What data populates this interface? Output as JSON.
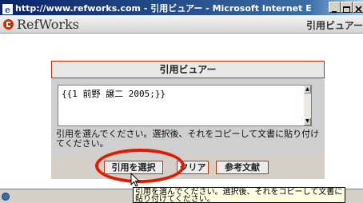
{
  "window": {
    "title": "http://www.refworks.com - 引用ビュアー - Microsoft Internet Explor..."
  },
  "header": {
    "logo_text": "RefWorks",
    "title": "引用ビュアー"
  },
  "panel": {
    "title": "引用ビュアー",
    "citation_text": "{{1 前野 譲二 2005;}}",
    "instructions": "引用を選んでください。選択後、それをコピーして文書に貼り付けてください。",
    "buttons": {
      "select": "引用を選択",
      "clear": "クリア",
      "references": "参考文献"
    }
  },
  "tooltip": {
    "text": "引用を選んでください。選択後、それをコピーして文書に貼り付けてください。"
  },
  "colors": {
    "accent": "#c83200",
    "highlight": "#e11a00"
  }
}
